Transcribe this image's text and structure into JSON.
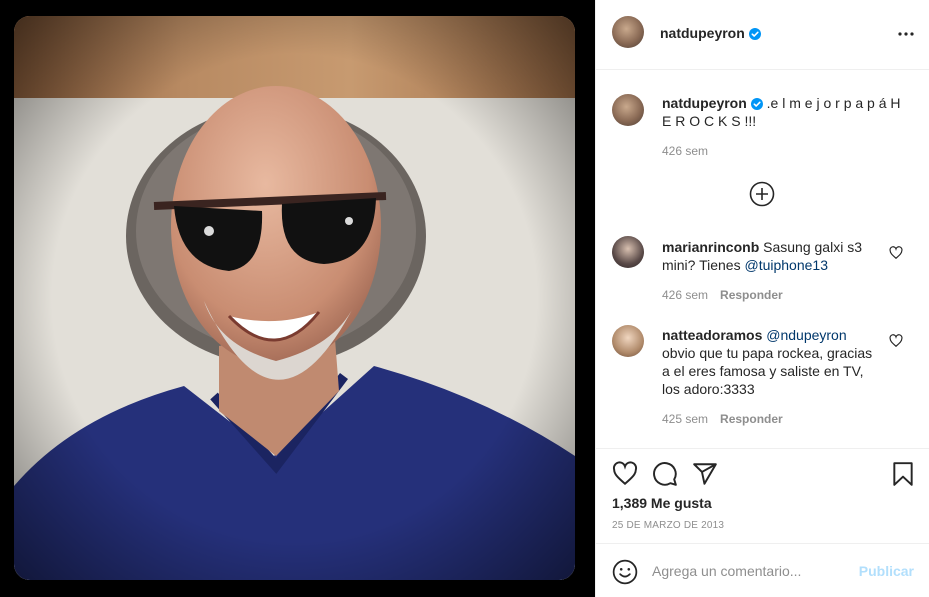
{
  "post": {
    "username": "natdupeyron",
    "verified": true,
    "photo_alt": "Smiling bald man with sunglasses and blue t-shirt"
  },
  "caption": {
    "username": "natdupeyron",
    "text_line1": ".e l m e j o r p a p á H",
    "text_line2": "E R O C K S !!!",
    "time": "426 sem"
  },
  "comments": [
    {
      "username": "marianrinconb",
      "text_before": "Sasung galxi s3",
      "text_line2_before": "mini? Tienes ",
      "mention": "@tuiphone13",
      "time": "426 sem",
      "reply": "Responder"
    },
    {
      "username": "natteadoramos",
      "mention": "@ndupeyron",
      "line2": "obvio que tu papa rockea, gracias",
      "line3": "a el eres famosa y saliste en TV,",
      "line4": "los adoro:3333",
      "time": "425 sem",
      "reply": "Responder"
    }
  ],
  "actions": {
    "likes": "1,389 Me gusta",
    "date": "25 DE MARZO DE 2013"
  },
  "add_comment": {
    "placeholder": "Agrega un comentario...",
    "publish": "Publicar"
  },
  "colors": {
    "verified": "#0095f6",
    "publish_disabled": "#b2dffc",
    "mention": "#00376b",
    "muted": "#8e8e8e"
  },
  "icons": [
    "more-icon",
    "verified-icon",
    "plus-circle-icon",
    "heart-icon",
    "comment-icon",
    "share-icon",
    "bookmark-icon",
    "emoji-icon"
  ]
}
